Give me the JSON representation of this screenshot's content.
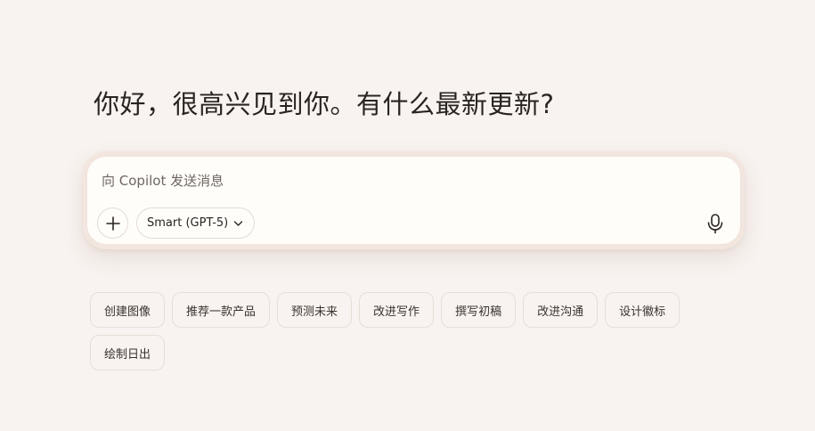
{
  "greeting": "你好，很高兴见到你。有什么最新更新?",
  "composer": {
    "placeholder": "向 Copilot 发送消息",
    "value": "",
    "add_icon": "plus-icon",
    "model_label": "Smart (GPT-5)",
    "model_dropdown_icon": "chevron-down-icon",
    "mic_icon": "microphone-icon"
  },
  "suggestions": {
    "row1": [
      "创建图像",
      "推荐一款产品",
      "预测未来",
      "改进写作",
      "撰写初稿",
      "改进沟通",
      "设计徽标"
    ],
    "row2": [
      "绘制日出"
    ]
  },
  "colors": {
    "background": "#f8f3f0",
    "composer_bg": "#fffdfa",
    "text": "#2b2420",
    "chip_border": "#e8ddd7"
  }
}
